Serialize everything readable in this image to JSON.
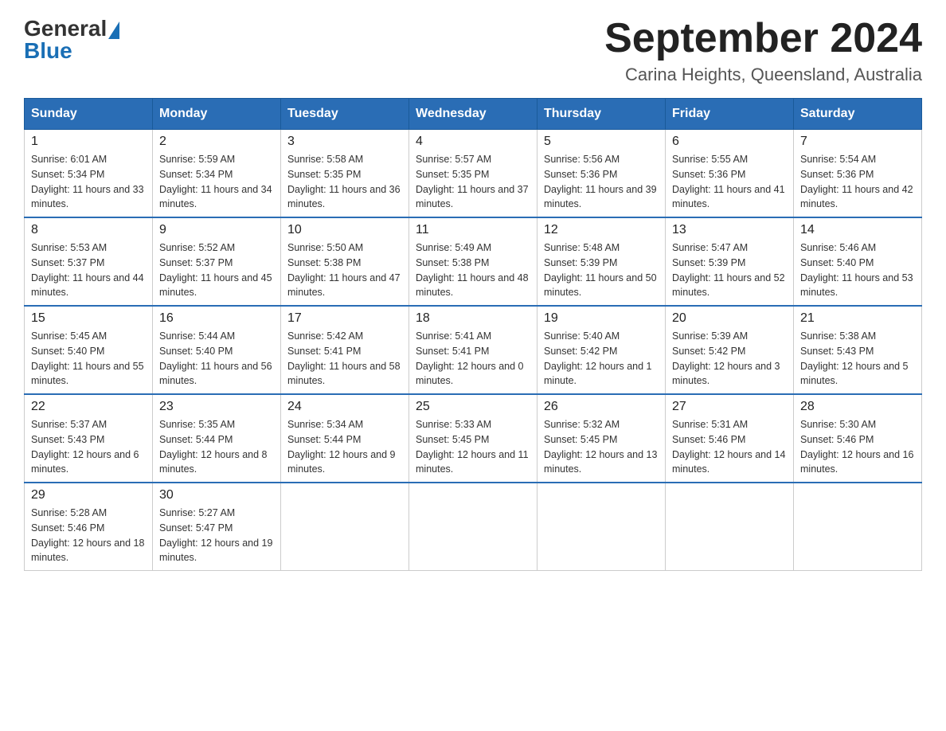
{
  "header": {
    "logo_general": "General",
    "logo_blue": "Blue",
    "title": "September 2024",
    "subtitle": "Carina Heights, Queensland, Australia"
  },
  "days_of_week": [
    "Sunday",
    "Monday",
    "Tuesday",
    "Wednesday",
    "Thursday",
    "Friday",
    "Saturday"
  ],
  "weeks": [
    [
      {
        "day": "1",
        "sunrise": "6:01 AM",
        "sunset": "5:34 PM",
        "daylight": "11 hours and 33 minutes."
      },
      {
        "day": "2",
        "sunrise": "5:59 AM",
        "sunset": "5:34 PM",
        "daylight": "11 hours and 34 minutes."
      },
      {
        "day": "3",
        "sunrise": "5:58 AM",
        "sunset": "5:35 PM",
        "daylight": "11 hours and 36 minutes."
      },
      {
        "day": "4",
        "sunrise": "5:57 AM",
        "sunset": "5:35 PM",
        "daylight": "11 hours and 37 minutes."
      },
      {
        "day": "5",
        "sunrise": "5:56 AM",
        "sunset": "5:36 PM",
        "daylight": "11 hours and 39 minutes."
      },
      {
        "day": "6",
        "sunrise": "5:55 AM",
        "sunset": "5:36 PM",
        "daylight": "11 hours and 41 minutes."
      },
      {
        "day": "7",
        "sunrise": "5:54 AM",
        "sunset": "5:36 PM",
        "daylight": "11 hours and 42 minutes."
      }
    ],
    [
      {
        "day": "8",
        "sunrise": "5:53 AM",
        "sunset": "5:37 PM",
        "daylight": "11 hours and 44 minutes."
      },
      {
        "day": "9",
        "sunrise": "5:52 AM",
        "sunset": "5:37 PM",
        "daylight": "11 hours and 45 minutes."
      },
      {
        "day": "10",
        "sunrise": "5:50 AM",
        "sunset": "5:38 PM",
        "daylight": "11 hours and 47 minutes."
      },
      {
        "day": "11",
        "sunrise": "5:49 AM",
        "sunset": "5:38 PM",
        "daylight": "11 hours and 48 minutes."
      },
      {
        "day": "12",
        "sunrise": "5:48 AM",
        "sunset": "5:39 PM",
        "daylight": "11 hours and 50 minutes."
      },
      {
        "day": "13",
        "sunrise": "5:47 AM",
        "sunset": "5:39 PM",
        "daylight": "11 hours and 52 minutes."
      },
      {
        "day": "14",
        "sunrise": "5:46 AM",
        "sunset": "5:40 PM",
        "daylight": "11 hours and 53 minutes."
      }
    ],
    [
      {
        "day": "15",
        "sunrise": "5:45 AM",
        "sunset": "5:40 PM",
        "daylight": "11 hours and 55 minutes."
      },
      {
        "day": "16",
        "sunrise": "5:44 AM",
        "sunset": "5:40 PM",
        "daylight": "11 hours and 56 minutes."
      },
      {
        "day": "17",
        "sunrise": "5:42 AM",
        "sunset": "5:41 PM",
        "daylight": "11 hours and 58 minutes."
      },
      {
        "day": "18",
        "sunrise": "5:41 AM",
        "sunset": "5:41 PM",
        "daylight": "12 hours and 0 minutes."
      },
      {
        "day": "19",
        "sunrise": "5:40 AM",
        "sunset": "5:42 PM",
        "daylight": "12 hours and 1 minute."
      },
      {
        "day": "20",
        "sunrise": "5:39 AM",
        "sunset": "5:42 PM",
        "daylight": "12 hours and 3 minutes."
      },
      {
        "day": "21",
        "sunrise": "5:38 AM",
        "sunset": "5:43 PM",
        "daylight": "12 hours and 5 minutes."
      }
    ],
    [
      {
        "day": "22",
        "sunrise": "5:37 AM",
        "sunset": "5:43 PM",
        "daylight": "12 hours and 6 minutes."
      },
      {
        "day": "23",
        "sunrise": "5:35 AM",
        "sunset": "5:44 PM",
        "daylight": "12 hours and 8 minutes."
      },
      {
        "day": "24",
        "sunrise": "5:34 AM",
        "sunset": "5:44 PM",
        "daylight": "12 hours and 9 minutes."
      },
      {
        "day": "25",
        "sunrise": "5:33 AM",
        "sunset": "5:45 PM",
        "daylight": "12 hours and 11 minutes."
      },
      {
        "day": "26",
        "sunrise": "5:32 AM",
        "sunset": "5:45 PM",
        "daylight": "12 hours and 13 minutes."
      },
      {
        "day": "27",
        "sunrise": "5:31 AM",
        "sunset": "5:46 PM",
        "daylight": "12 hours and 14 minutes."
      },
      {
        "day": "28",
        "sunrise": "5:30 AM",
        "sunset": "5:46 PM",
        "daylight": "12 hours and 16 minutes."
      }
    ],
    [
      {
        "day": "29",
        "sunrise": "5:28 AM",
        "sunset": "5:46 PM",
        "daylight": "12 hours and 18 minutes."
      },
      {
        "day": "30",
        "sunrise": "5:27 AM",
        "sunset": "5:47 PM",
        "daylight": "12 hours and 19 minutes."
      },
      null,
      null,
      null,
      null,
      null
    ]
  ],
  "labels": {
    "sunrise": "Sunrise:",
    "sunset": "Sunset:",
    "daylight": "Daylight:"
  }
}
